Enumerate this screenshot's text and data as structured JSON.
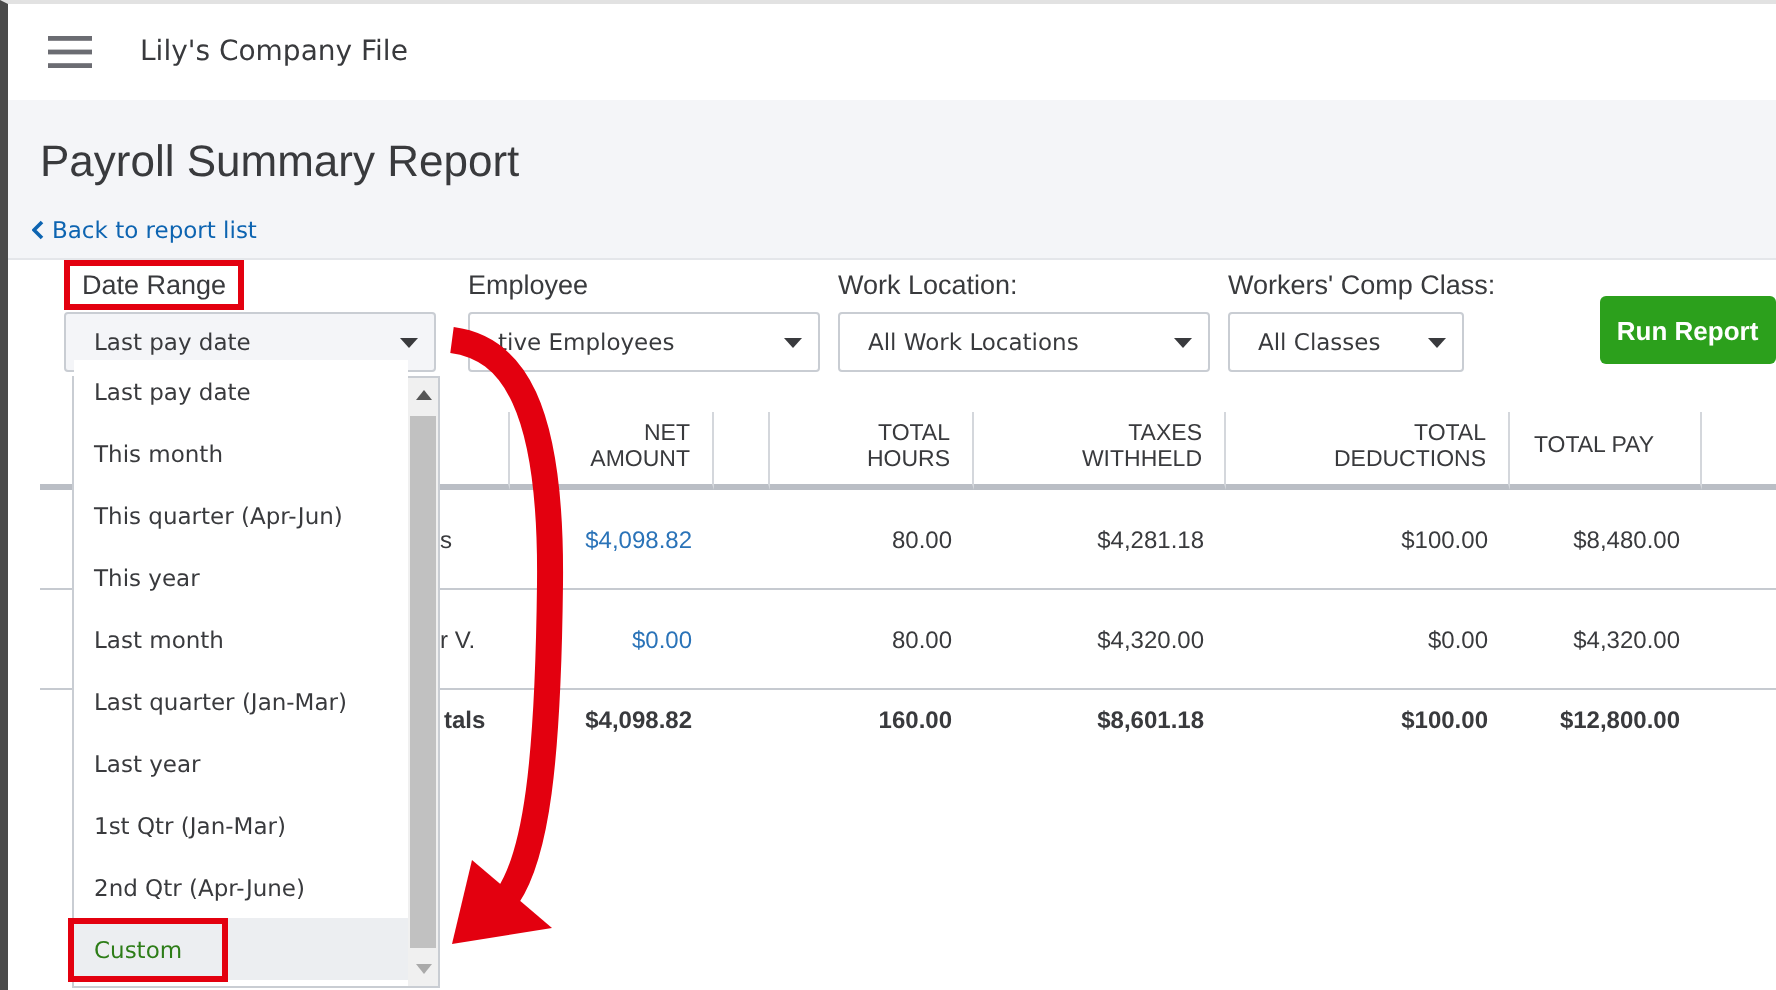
{
  "header": {
    "company": "Lily's Company File"
  },
  "report": {
    "title": "Payroll Summary Report",
    "back_link": "Back to report list"
  },
  "filters": [
    {
      "label": "Date Range",
      "value": "Last pay date",
      "highlighted": true
    },
    {
      "label": "Employee",
      "value": "tive Employees",
      "highlighted": false
    },
    {
      "label": "Work Location:",
      "value": "All Work Locations",
      "highlighted": false
    },
    {
      "label": "Workers' Comp Class:",
      "value": "All Classes",
      "highlighted": false
    }
  ],
  "run_button": "Run Report",
  "date_menu": {
    "items": [
      {
        "label": "Last pay date",
        "selected": false,
        "highlighted": false
      },
      {
        "label": "This month",
        "selected": false,
        "highlighted": false
      },
      {
        "label": "This quarter (Apr-Jun)",
        "selected": false,
        "highlighted": false
      },
      {
        "label": "This year",
        "selected": false,
        "highlighted": false
      },
      {
        "label": "Last month",
        "selected": false,
        "highlighted": false
      },
      {
        "label": "Last quarter (Jan-Mar)",
        "selected": false,
        "highlighted": false
      },
      {
        "label": "Last year",
        "selected": false,
        "highlighted": false
      },
      {
        "label": "1st Qtr (Jan-Mar)",
        "selected": false,
        "highlighted": false
      },
      {
        "label": "2nd Qtr (Apr-June)",
        "selected": false,
        "highlighted": false
      },
      {
        "label": "Custom",
        "selected": true,
        "highlighted": true
      }
    ]
  },
  "table": {
    "columns": [
      "NET AMOUNT",
      "TOTAL HOURS",
      "TAXES WITHHELD",
      "TOTAL DEDUCTIONS",
      "TOTAL PAY"
    ],
    "rows": [
      {
        "name": "s",
        "cells": [
          "$4,098.82",
          "80.00",
          "$4,281.18",
          "$100.00",
          "$8,480.00"
        ]
      },
      {
        "name": "r V.",
        "cells": [
          "$0.00",
          "80.00",
          "$4,320.00",
          "$0.00",
          "$4,320.00"
        ]
      }
    ],
    "totals": {
      "label": "tals",
      "cells": [
        "$4,098.82",
        "160.00",
        "$8,601.18",
        "$100.00",
        "$12,800.00"
      ]
    }
  }
}
